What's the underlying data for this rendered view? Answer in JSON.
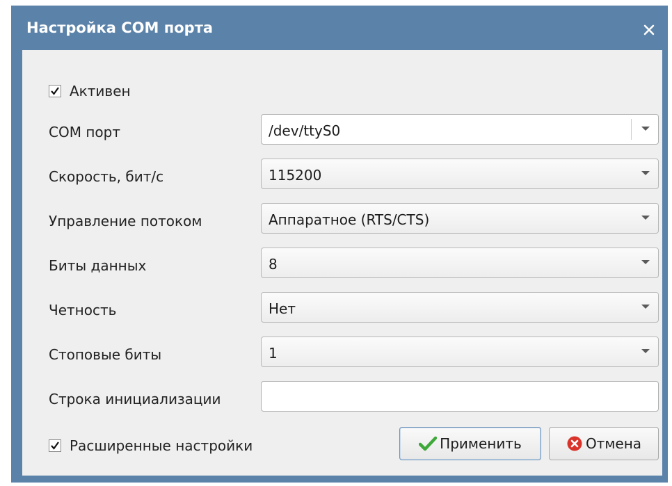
{
  "window": {
    "title": "Настройка COM порта",
    "close_icon": "close-icon"
  },
  "active_checkbox": {
    "label": "Активен",
    "checked": true
  },
  "fields": {
    "com_port": {
      "label": "COM порт",
      "value": "/dev/ttyS0"
    },
    "speed": {
      "label": "Скорость, бит/с",
      "value": "115200"
    },
    "flow_control": {
      "label": "Управление потоком",
      "value": "Аппаратное (RTS/CTS)"
    },
    "data_bits": {
      "label": "Биты данных",
      "value": "8"
    },
    "parity": {
      "label": "Четность",
      "value": "Нет"
    },
    "stop_bits": {
      "label": "Стоповые биты",
      "value": "1"
    },
    "init_string": {
      "label": "Строка инициализации",
      "value": ""
    }
  },
  "advanced_checkbox": {
    "label": "Расширенные настройки",
    "checked": true
  },
  "buttons": {
    "apply": {
      "label": "Применить",
      "icon": "green-check-icon"
    },
    "cancel": {
      "label": "Отмена",
      "icon": "red-cancel-icon"
    }
  },
  "colors": {
    "titlebar": "#5b82a8",
    "content_bg": "#efefef",
    "check_green": "#3fa83a",
    "cancel_red": "#d9342b"
  }
}
